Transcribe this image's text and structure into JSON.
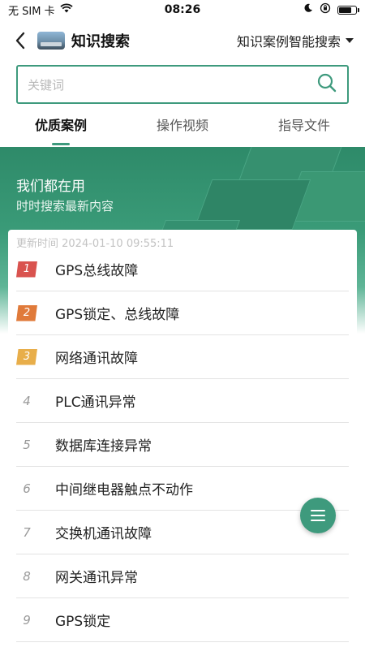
{
  "status_bar": {
    "carrier": "无 SIM 卡",
    "time": "08:26",
    "battery_level": 0.8
  },
  "nav": {
    "title": "知识搜索",
    "dropdown_label": "知识案例智能搜索"
  },
  "search": {
    "placeholder": "关键词",
    "accent_color": "#3e9a7d"
  },
  "tabs": [
    {
      "label": "优质案例",
      "active": true
    },
    {
      "label": "操作视频",
      "active": false
    },
    {
      "label": "指导文件",
      "active": false
    }
  ],
  "banner": {
    "title": "我们都在用",
    "subtitle": "时时搜索最新内容"
  },
  "ranking": {
    "update_time": "更新时间 2024-01-10 09:55:11",
    "items": [
      {
        "rank": "1",
        "label": "GPS总线故障",
        "badge_color": "#d9534f"
      },
      {
        "rank": "2",
        "label": "GPS锁定、总线故障",
        "badge_color": "#e07a3a"
      },
      {
        "rank": "3",
        "label": "网络通讯故障",
        "badge_color": "#e8ae4a"
      },
      {
        "rank": "4",
        "label": "PLC通讯异常"
      },
      {
        "rank": "5",
        "label": "数据库连接异常"
      },
      {
        "rank": "6",
        "label": "中间继电器触点不动作"
      },
      {
        "rank": "7",
        "label": "交换机通讯故障"
      },
      {
        "rank": "8",
        "label": "网关通讯异常"
      },
      {
        "rank": "9",
        "label": "GPS锁定"
      }
    ]
  },
  "icons": {
    "back": "chevron-left-icon",
    "search": "search-icon",
    "menu": "menu-icon",
    "wifi": "wifi-icon",
    "moon": "moon-icon",
    "lock_rotation": "orientation-lock-icon",
    "battery": "battery-icon"
  }
}
